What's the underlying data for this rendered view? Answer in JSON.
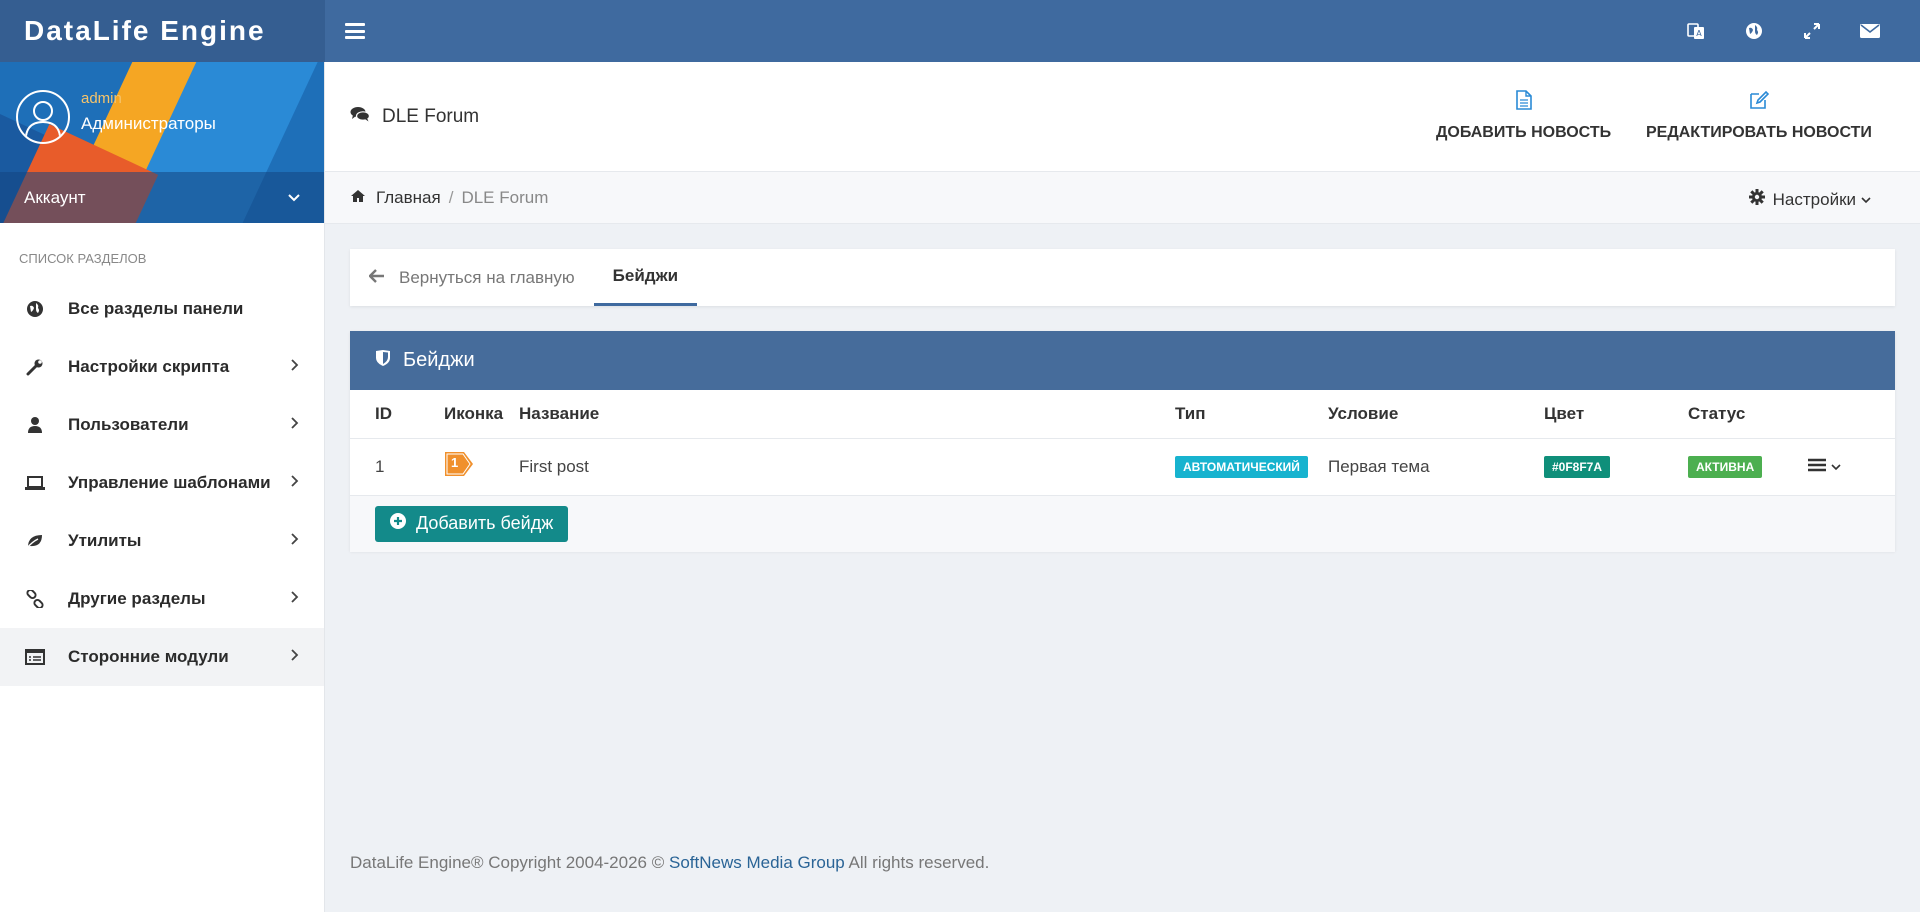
{
  "brand": "DataLife Engine",
  "top_icons": [
    "translate-icon",
    "globe-icon",
    "expand-icon",
    "envelope-icon"
  ],
  "user": {
    "name": "admin",
    "group": "Администраторы",
    "account_label": "Аккаунт"
  },
  "sidebar": {
    "section_title": "СПИСОК РАЗДЕЛОВ",
    "items": [
      {
        "label": "Все разделы панели",
        "icon": "globe-icon",
        "has_chevron": false
      },
      {
        "label": "Настройки скрипта",
        "icon": "wrench-icon",
        "has_chevron": true
      },
      {
        "label": "Пользователи",
        "icon": "user-icon",
        "has_chevron": true
      },
      {
        "label": "Управление шаблонами",
        "icon": "laptop-icon",
        "has_chevron": true
      },
      {
        "label": "Утилиты",
        "icon": "leaf-icon",
        "has_chevron": true
      },
      {
        "label": "Другие разделы",
        "icon": "link-icon",
        "has_chevron": true
      },
      {
        "label": "Сторонние модули",
        "icon": "list-alt-icon",
        "has_chevron": true
      }
    ]
  },
  "header": {
    "title": "DLE Forum",
    "actions": [
      {
        "label": "ДОБАВИТЬ НОВОСТЬ",
        "icon": "file-icon"
      },
      {
        "label": "РЕДАКТИРОВАТЬ НОВОСТИ",
        "icon": "edit-icon"
      }
    ]
  },
  "breadcrumb": {
    "home": "Главная",
    "separator": "/",
    "current": "DLE Forum",
    "settings": "Настройки"
  },
  "tabs": [
    {
      "label": "Вернуться на главную",
      "active": false
    },
    {
      "label": "Бейджи",
      "active": true
    }
  ],
  "badges_card": {
    "title": "Бейджи",
    "columns": [
      "ID",
      "Иконка",
      "Название",
      "Тип",
      "Условие",
      "Цвет",
      "Статус"
    ],
    "rows": [
      {
        "id": "1",
        "icon_number": "1",
        "name": "First post",
        "type": "АВТОМАТИЧЕСКИЙ",
        "condition": "Первая тема",
        "color": "#0F8F7A",
        "status": "АКТИВНА"
      }
    ],
    "add_button": "Добавить бейдж"
  },
  "colors": {
    "topbar": "#3f6a9f",
    "card_header": "#466c9b",
    "type_badge": "#17b3cf",
    "status_badge": "#4caf50",
    "add_button": "#138a8a",
    "icon_badge": "#f0902c"
  },
  "footer": {
    "prefix": "DataLife Engine® Copyright 2004-2026 ©",
    "link": "SoftNews Media Group",
    "suffix": "All rights reserved."
  }
}
